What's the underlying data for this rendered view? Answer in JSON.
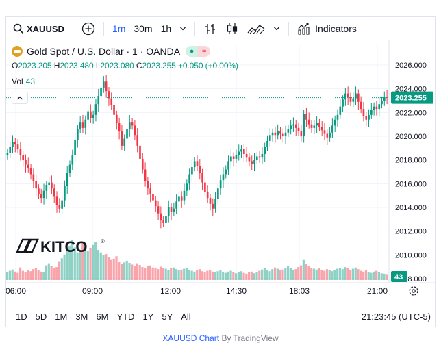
{
  "toolbar": {
    "symbol": "XAUUSD",
    "timeframes": [
      "1m",
      "30m",
      "1h"
    ],
    "active_timeframe": "1m",
    "indicators_label": "Indicators",
    "add_icon": "plus-circle-icon",
    "search_icon": "search-icon",
    "compare_icon": "bar-style-icon",
    "candle_icon": "candles-icon",
    "area_icon": "area-chart-icon"
  },
  "legend": {
    "title": "Gold Spot / U.S. Dollar · 1 · OANDA",
    "open_label": "O",
    "open": "2023.205",
    "high_label": "H",
    "high": "2023.480",
    "low_label": "L",
    "low": "2023.080",
    "close_label": "C",
    "close": "2023.255",
    "change": "+0.050 (+0.00%)",
    "vol_label": "Vol",
    "vol_value": "43"
  },
  "watermark": {
    "text": "KITCO",
    "registered": "®"
  },
  "bottom": {
    "ranges": [
      "1D",
      "5D",
      "1M",
      "3M",
      "6M",
      "YTD",
      "1Y",
      "5Y",
      "All"
    ],
    "clock": "21:23:45 (UTC-5)"
  },
  "footer": {
    "link_text": "XAUUSD Chart",
    "by_text": "By TradingView"
  },
  "colors": {
    "up": "#089981",
    "down": "#f23645",
    "accent": "#2962ff",
    "grid": "#f0f3fa"
  },
  "chart_data": {
    "type": "candlestick",
    "y_ticks": [
      "2026.000",
      "2024.000",
      "2022.000",
      "2020.000",
      "2018.000",
      "2016.000",
      "2014.000",
      "2012.000",
      "2010.000",
      "2008.000"
    ],
    "x_ticks": [
      "06:00",
      "09:00",
      "12:00",
      "14:30",
      "18:03",
      "21:00"
    ],
    "ylim": [
      2008,
      2026
    ],
    "last_price": "2023.255",
    "volume_label": "43",
    "close_series": [
      2018.6,
      2019.1,
      2019.5,
      2019.3,
      2018.9,
      2018.4,
      2018.0,
      2017.6,
      2017.3,
      2016.8,
      2016.2,
      2015.6,
      2015.1,
      2014.8,
      2015.4,
      2015.9,
      2016.1,
      2015.6,
      2014.9,
      2014.2,
      2013.9,
      2014.6,
      2015.8,
      2016.9,
      2017.6,
      2018.4,
      2019.7,
      2020.6,
      2021.2,
      2020.7,
      2021.4,
      2022.1,
      2021.5,
      2021.8,
      2022.7,
      2023.4,
      2024.1,
      2024.6,
      2023.8,
      2023.2,
      2022.6,
      2021.8,
      2021.1,
      2020.4,
      2019.2,
      2019.8,
      2020.6,
      2021.2,
      2020.9,
      2020.1,
      2019.2,
      2018.1,
      2017.2,
      2016.2,
      2015.6,
      2015.1,
      2014.6,
      2014.1,
      2013.5,
      2012.9,
      2012.7,
      2013.3,
      2014.0,
      2013.6,
      2013.9,
      2014.5,
      2014.9,
      2014.6,
      2015.4,
      2016.0,
      2016.8,
      2017.4,
      2017.9,
      2017.5,
      2016.9,
      2016.1,
      2015.3,
      2014.8,
      2014.3,
      2013.9,
      2014.7,
      2015.6,
      2016.3,
      2016.8,
      2017.2,
      2017.9,
      2018.3,
      2018.1,
      2018.4,
      2018.7,
      2018.9,
      2018.5,
      2018.2,
      2017.9,
      2017.7,
      2018.0,
      2018.3,
      2018.2,
      2018.5,
      2019.1,
      2019.6,
      2020.1,
      2020.3,
      2020.1,
      2020.4,
      2020.2,
      2020.0,
      2020.3,
      2020.6,
      2020.9,
      2021.0,
      2020.7,
      2020.4,
      2020.0,
      2021.9,
      2021.4,
      2021.0,
      2020.7,
      2020.9,
      2021.1,
      2020.8,
      2020.5,
      2020.2,
      2019.9,
      2020.3,
      2020.9,
      2021.4,
      2021.8,
      2022.5,
      2023.1,
      2023.6,
      2023.3,
      2022.9,
      2023.2,
      2023.6,
      2022.9,
      2022.3,
      2021.7,
      2021.4,
      2021.8,
      2022.2,
      2022.5,
      2022.3,
      2022.7,
      2023.0,
      2023.3,
      2023.255
    ],
    "volume_series": [
      18,
      22,
      25,
      20,
      17,
      30,
      22,
      19,
      24,
      21,
      26,
      28,
      23,
      20,
      19,
      35,
      40,
      33,
      28,
      31,
      45,
      52,
      61,
      70,
      82,
      95,
      78,
      66,
      71,
      88,
      74,
      69,
      77,
      84,
      90,
      72,
      66,
      59,
      62,
      55,
      48,
      51,
      57,
      44,
      39,
      42,
      46,
      41,
      37,
      34,
      40,
      36,
      31,
      29,
      33,
      35,
      30,
      28,
      26,
      32,
      29,
      27,
      24,
      28,
      30,
      26,
      23,
      25,
      27,
      29,
      24,
      22,
      20,
      23,
      26,
      21,
      19,
      22,
      24,
      20,
      18,
      21,
      23,
      19,
      17,
      20,
      22,
      18,
      16,
      19,
      21,
      17,
      15,
      18,
      20,
      16,
      19,
      22,
      25,
      28,
      24,
      21,
      26,
      30,
      27,
      23,
      25,
      29,
      33,
      28,
      24,
      26,
      31,
      35,
      48,
      38,
      33,
      29,
      27,
      25,
      28,
      24,
      22,
      26,
      23,
      21,
      24,
      27,
      29,
      26,
      31,
      28,
      24,
      27,
      30,
      26,
      22,
      20,
      23,
      19,
      17,
      20,
      22,
      18,
      16,
      15,
      14
    ]
  }
}
